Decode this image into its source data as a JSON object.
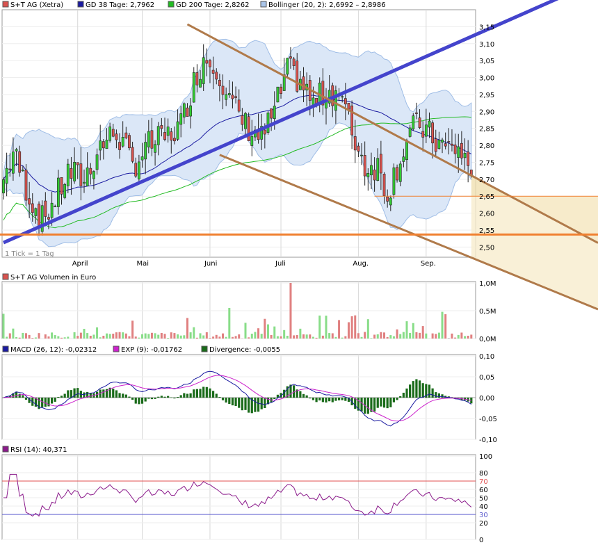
{
  "chart_data": [
    {
      "type": "candlestick",
      "title": "S+T AG (Xetra)",
      "x_ticks": [
        "April",
        "Mai",
        "Juni",
        "Juli",
        "Aug.",
        "Sep."
      ],
      "y_ticks": [
        "3,15",
        "3,10",
        "3,05",
        "3,00",
        "2,95",
        "2,90",
        "2,85",
        "2,80",
        "2,75",
        "2,70",
        "2,65",
        "2,60",
        "2,55",
        "2,50"
      ],
      "ylim": [
        2.47,
        3.2
      ],
      "note": "1 Tick = 1 Tag",
      "legend": [
        {
          "label": "S+T AG (Xetra)",
          "color": "#d9534f"
        },
        {
          "label": "GD 38 Tage: 2,7962",
          "color": "#1a1aa0"
        },
        {
          "label": "GD 200 Tage: 2,8262",
          "color": "#22bb22"
        },
        {
          "label": "Bollinger (20, 2): 2,6992 – 2,8986",
          "color": "#a9c4e8"
        }
      ],
      "horizontal_lines": [
        2.537,
        2.65
      ],
      "trend_lines": [
        {
          "name": "uptrend",
          "from": [
            0,
            2.513
          ],
          "to": [
            146,
            3.125
          ]
        },
        {
          "name": "channel-top",
          "from": [
            57,
            3.157
          ],
          "to": [
            146,
            2.706
          ]
        },
        {
          "name": "channel-bottom",
          "from": [
            67,
            2.772
          ],
          "to": [
            146,
            2.465
          ]
        }
      ]
    },
    {
      "type": "bar",
      "title": "S+T AG Volumen in Euro",
      "y_ticks": [
        "1,0M",
        "0,5M",
        "0,0M"
      ],
      "ylim": [
        0,
        1.0
      ]
    },
    {
      "type": "line",
      "title": "MACD",
      "legend": [
        {
          "label": "MACD (26, 12): -0,02312",
          "color": "#1a1aa0"
        },
        {
          "label": "EXP (9): -0,01762",
          "color": "#cc22cc"
        },
        {
          "label": "Divergence: -0,0055",
          "color": "#1a6b1a"
        }
      ],
      "y_ticks": [
        "0,10",
        "0,05",
        "0,00",
        "-0,05",
        "-0,10"
      ],
      "ylim": [
        -0.1,
        0.1
      ]
    },
    {
      "type": "line",
      "title": "RSI",
      "legend": [
        {
          "label": "RSI (14): 40,371",
          "color": "#8b1a8b"
        }
      ],
      "y_ticks": [
        "100",
        "80",
        "70",
        "60",
        "50",
        "40",
        "30",
        "20",
        "0"
      ],
      "ylim": [
        0,
        100
      ]
    }
  ],
  "icons": {
    "legend_marker": "square-swatch"
  }
}
